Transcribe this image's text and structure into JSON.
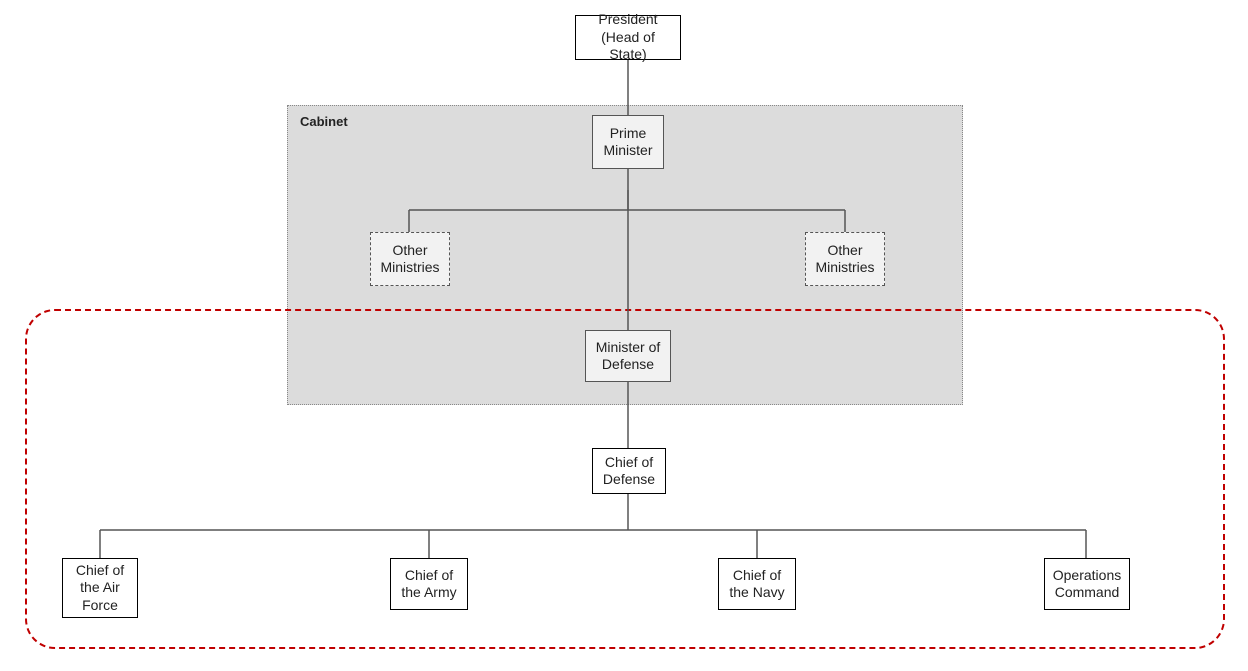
{
  "nodes": {
    "president_l1": "President",
    "president_l2": "(Head of State)",
    "cabinet_label": "Cabinet",
    "prime_minister_l1": "Prime",
    "prime_minister_l2": "Minister",
    "other_ministries_left_l1": "Other",
    "other_ministries_left_l2": "Ministries",
    "other_ministries_right_l1": "Other",
    "other_ministries_right_l2": "Ministries",
    "minister_defense_l1": "Minister of",
    "minister_defense_l2": "Defense",
    "chief_defense_l1": "Chief of",
    "chief_defense_l2": "Defense",
    "chief_air_l1": "Chief of",
    "chief_air_l2": "the Air",
    "chief_air_l3": "Force",
    "chief_army_l1": "Chief of",
    "chief_army_l2": "the Army",
    "chief_navy_l1": "Chief of",
    "chief_navy_l2": "the Navy",
    "ops_cmd_l1": "Operations",
    "ops_cmd_l2": "Command"
  }
}
